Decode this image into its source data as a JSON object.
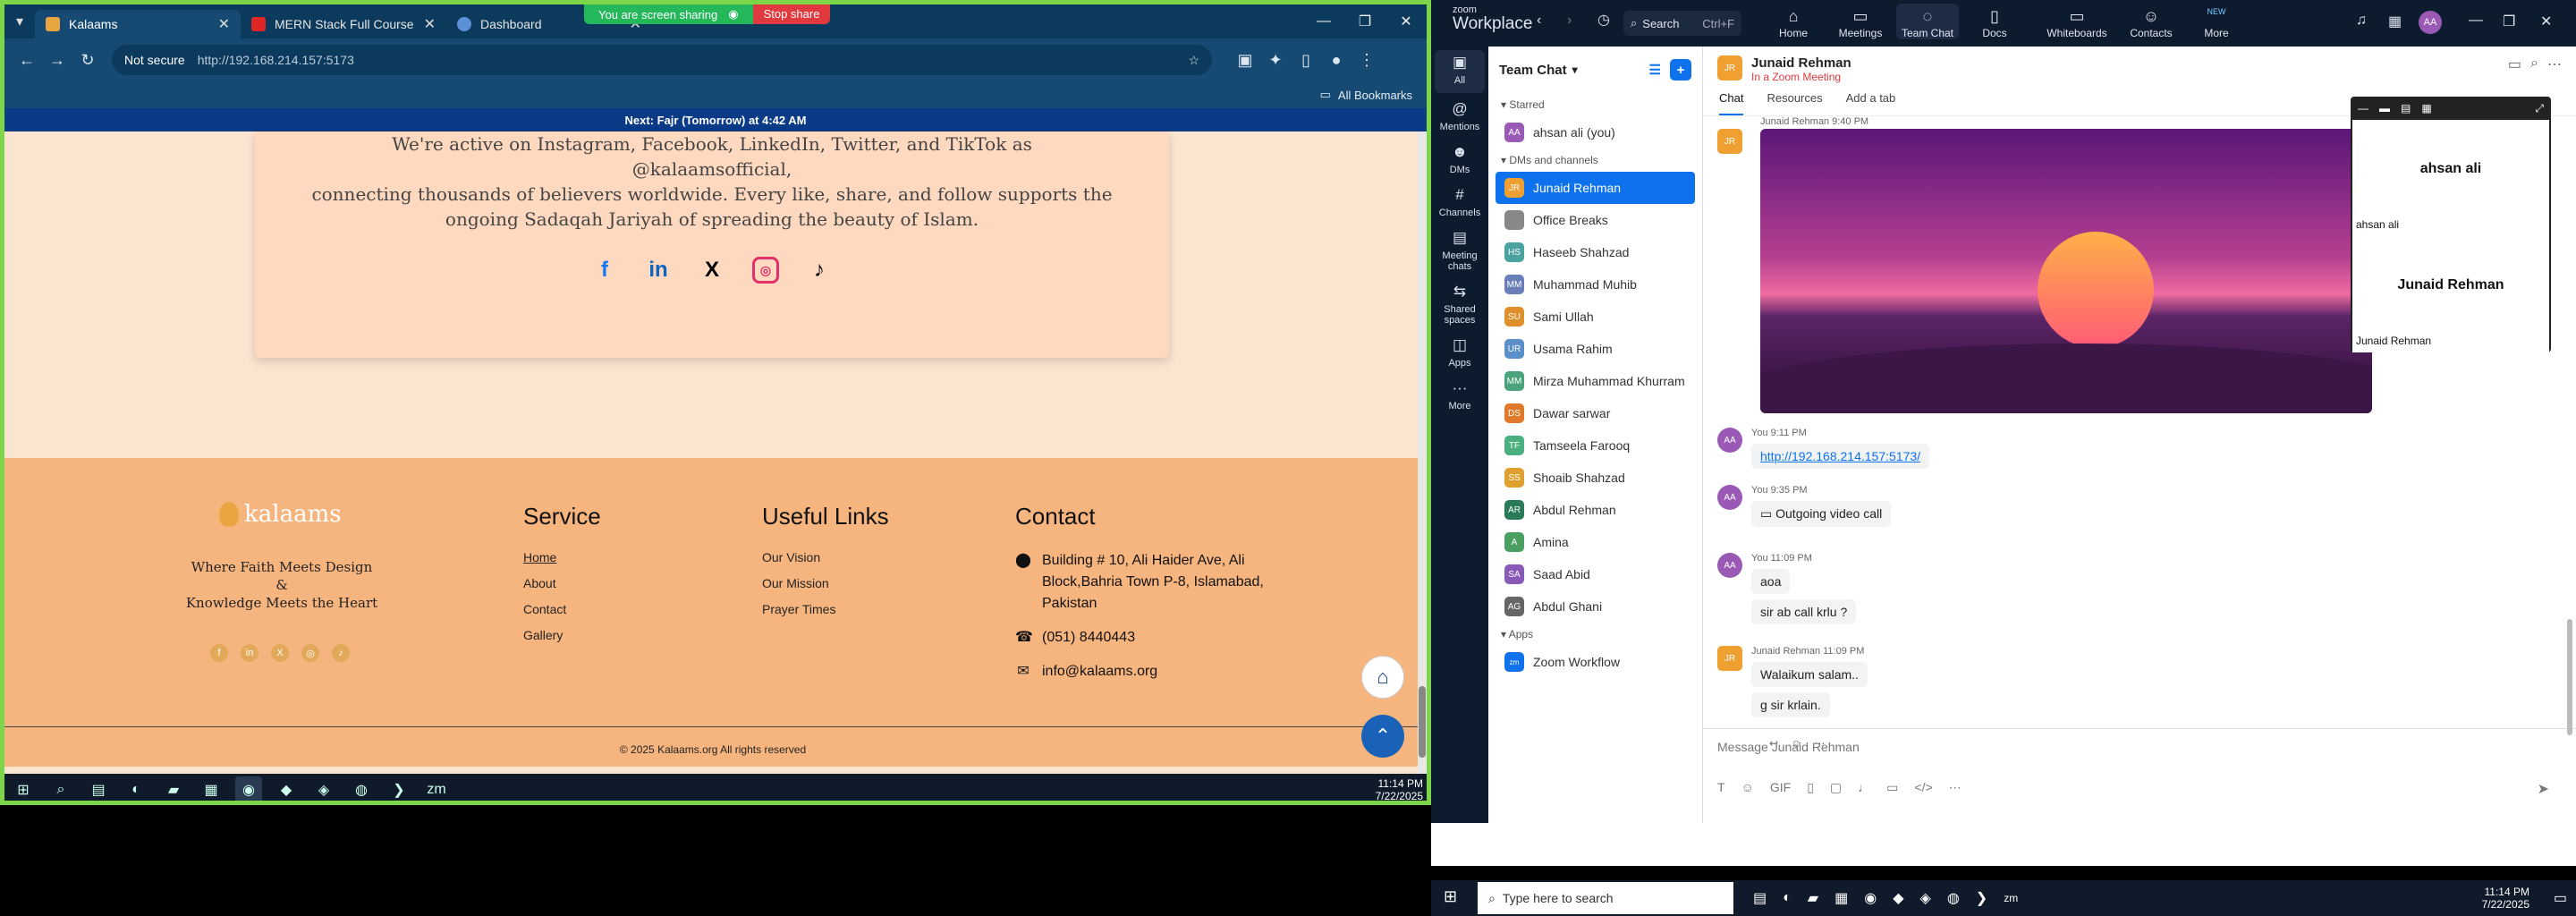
{
  "browser": {
    "tabs": [
      {
        "title": "Kalaams",
        "active": true,
        "color": "#e9a640"
      },
      {
        "title": "MERN Stack Full Course - ECom",
        "active": false,
        "color": "#e02525"
      },
      {
        "title": "Dashboard",
        "active": false,
        "color": "#5b8fd6"
      }
    ],
    "sharing_text": "You are screen sharing",
    "stop_share": "Stop share",
    "not_secure": "Not secure",
    "url": "http://192.168.214.157:5173",
    "bookmarks": "All Bookmarks",
    "prayer_bar": "Next: Fajr (Tomorrow) at 4:42 AM"
  },
  "page": {
    "intro_l1": "We're active on Instagram, Facebook, LinkedIn, Twitter, and TikTok as @kalaamsofficial,",
    "intro_l2": "connecting thousands of believers worldwide. Every like, share, and follow supports the",
    "intro_l3": "ongoing Sadaqah Jariyah of spreading the beauty of Islam.",
    "logo": "kalaams",
    "tag1": "Where Faith Meets Design",
    "tag2": "&",
    "tag3": "Knowledge Meets the Heart",
    "service_h": "Service",
    "service": [
      "Home",
      "About",
      "Contact",
      "Gallery"
    ],
    "links_h": "Useful Links",
    "links": [
      "Our Vision",
      "Our Mission",
      "Prayer Times"
    ],
    "contact_h": "Contact",
    "address": "Building # 10, Ali Haider Ave, Ali Block,Bahria Town P-8, Islamabad, Pakistan",
    "phone": "(051) 8440443",
    "email": "info@kalaams.org",
    "copyright": "© 2025 Kalaams.org All rights reserved"
  },
  "left_clock": {
    "time": "11:14 PM",
    "date": "7/22/2025"
  },
  "zoom": {
    "brand_top": "zoom",
    "brand": "Workplace",
    "search": "Search",
    "search_hint": "Ctrl+F",
    "nav": [
      "Home",
      "Meetings",
      "Team Chat",
      "Docs",
      "Whiteboards",
      "Contacts",
      "More"
    ],
    "new_badge": "NEW",
    "rail": [
      "All",
      "Mentions",
      "DMs",
      "Channels",
      "Meeting chats",
      "Shared spaces",
      "Apps",
      "More"
    ],
    "list_title": "Team Chat",
    "starred": "Starred",
    "me": "ahsan ali (you)",
    "dms_h": "DMs and channels",
    "contacts": [
      {
        "name": "Junaid Rehman",
        "ini": "JR",
        "color": "#f0a030"
      },
      {
        "name": "Office Breaks",
        "ini": "",
        "color": "#888"
      },
      {
        "name": "Haseeb Shahzad",
        "ini": "HS",
        "color": "#4aa3a0"
      },
      {
        "name": "Muhammad Muhib",
        "ini": "MM",
        "color": "#6a7fb8"
      },
      {
        "name": "Sami Ullah",
        "ini": "SU",
        "color": "#e0902a"
      },
      {
        "name": "Usama Rahim",
        "ini": "UR",
        "color": "#5a8fc8"
      },
      {
        "name": "Mirza Muhammad Khurram",
        "ini": "MM",
        "color": "#4aa37a"
      },
      {
        "name": "Dawar sarwar",
        "ini": "DS",
        "color": "#e07a2a"
      },
      {
        "name": "Tamseela Farooq",
        "ini": "TF",
        "color": "#4ab080"
      },
      {
        "name": "Shoaib Shahzad",
        "ini": "SS",
        "color": "#e0a030"
      },
      {
        "name": "Abdul Rehman",
        "ini": "AR",
        "color": "#2a7a5a"
      },
      {
        "name": "Amina",
        "ini": "A",
        "color": "#4aa060"
      },
      {
        "name": "Saad Abid",
        "ini": "SA",
        "color": "#8a5ab8"
      },
      {
        "name": "Abdul Ghani",
        "ini": "AG",
        "color": "#666"
      }
    ],
    "apps_h": "Apps",
    "workflow": "Zoom Workflow",
    "chat_name": "Junaid Rehman",
    "chat_status": "In a Zoom Meeting",
    "tabs": [
      "Chat",
      "Resources",
      "Add a tab"
    ],
    "top_meta": "Junaid Rehman 9:40 PM",
    "m1_meta": "You 9:11 PM",
    "m1_link": "http://192.168.214.157:5173/",
    "m2_meta": "You 9:35 PM",
    "m2_text": "Outgoing video call",
    "m3_meta": "You 11:09 PM",
    "m3_a": "aoa",
    "m3_b": "sir ab call krlu ?",
    "m4_meta": "Junaid Rehman 11:09 PM",
    "m4_a": "Walaikum salam..",
    "m4_b": "g sir krlain.",
    "compose": "Message Junaid Rehman",
    "mini_p1": "ahsan ali",
    "mini_p1_tag": "ahsan ali",
    "mini_p2": "Junaid Rehman",
    "mini_p2_tag": "Junaid Rehman",
    "avatar_me": "AA",
    "avatar_jr": "JR"
  },
  "right_task": {
    "search": "Type here to search",
    "time": "11:14 PM",
    "date": "7/22/2025"
  },
  "colors": {
    "accent": "#0e72ed",
    "share_green": "#25b85a",
    "stop_red": "#e0393e",
    "footer": "#f6b57f"
  }
}
